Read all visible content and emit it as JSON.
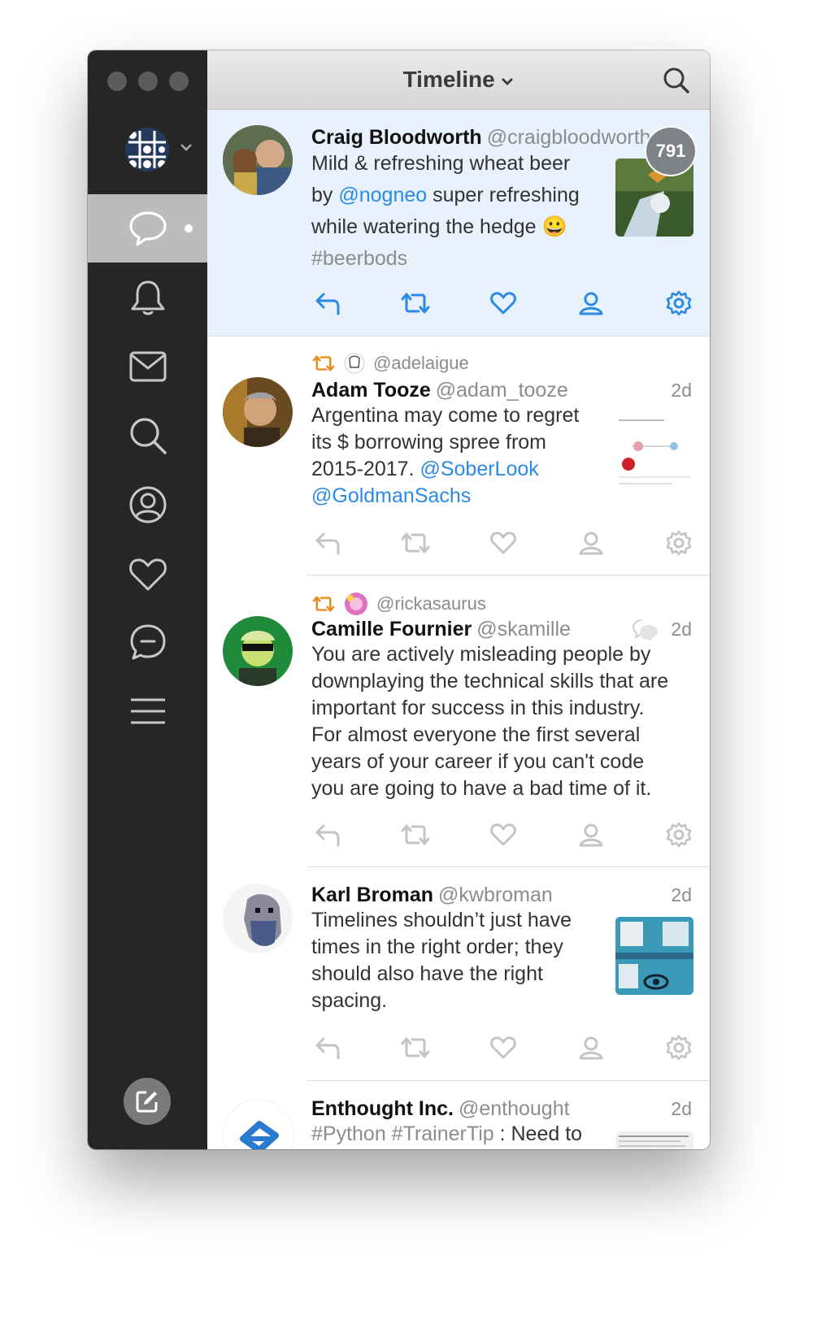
{
  "window": {
    "title": "Timeline"
  },
  "sidebar": {
    "nav": [
      {
        "name": "messages",
        "icon": "speech-bubble-icon",
        "active": true
      },
      {
        "name": "notifications",
        "icon": "bell-icon"
      },
      {
        "name": "direct-messages",
        "icon": "envelope-icon"
      },
      {
        "name": "search",
        "icon": "search-icon"
      },
      {
        "name": "profile",
        "icon": "user-circle-icon"
      },
      {
        "name": "likes",
        "icon": "heart-icon"
      },
      {
        "name": "mentions",
        "icon": "chat-ellipsis-icon"
      },
      {
        "name": "menu",
        "icon": "hamburger-icon"
      }
    ],
    "compose_icon": "compose-icon"
  },
  "colors": {
    "accent": "#2a8ae6",
    "retweet": "#f08a24",
    "sidebar": "#262627",
    "selected_bg": "#e8f2fd"
  },
  "unread_badge": "791",
  "tweets": [
    {
      "name": "Craig Bloodworth",
      "handle": "@craigbloodworth",
      "text_parts": [
        "Mild & refreshing wheat beer",
        "by ",
        "@nogneo",
        " super refreshing",
        "while watering the hedge 😀",
        "#beerbods"
      ]
    },
    {
      "retweeted_by": "@adelaigue",
      "name": "Adam Tooze",
      "handle": "@adam_tooze",
      "time": "2d",
      "text_parts": [
        "Argentina may come to regret",
        "its $ borrowing spree from",
        "2015-2017. ",
        "@SoberLook",
        "@GoldmanSachs"
      ]
    },
    {
      "retweeted_by": "@rickasaurus",
      "name": "Camille Fournier",
      "handle": "@skamille",
      "time": "2d",
      "lines": [
        "You are actively misleading people by",
        "downplaying the technical skills that are",
        "important for success in this industry.",
        "For almost everyone the first several",
        "years of your career if you can't code",
        "you are going to have a bad time of it."
      ]
    },
    {
      "name": "Karl Broman",
      "handle": "@kwbroman",
      "time": "2d",
      "lines": [
        "Timelines shouldn’t just have",
        "times in the right order; they",
        "should also have the right",
        "spacing."
      ]
    },
    {
      "name": "Enthought Inc.",
      "handle": "@enthought",
      "time": "2d",
      "text_parts": [
        "#Python #TrainerTip",
        " : Need to"
      ]
    }
  ]
}
